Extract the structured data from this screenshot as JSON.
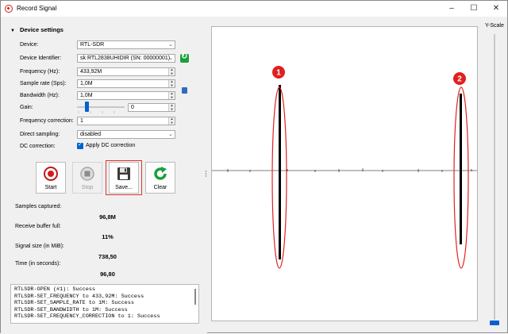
{
  "window": {
    "title": "Record Signal",
    "minimize": "–",
    "maximize": "☐",
    "close": "✕"
  },
  "device_settings": {
    "header": "Device settings",
    "device": {
      "label": "Device:",
      "value": "RTL-SDR"
    },
    "identifier": {
      "label": "Device Identifier:",
      "value": "sk RTL2838UHIDIR (SN: 00000001)"
    },
    "frequency": {
      "label": "Frequency (Hz):",
      "value": "433,92M"
    },
    "sample_rate": {
      "label": "Sample rate (Sps):",
      "value": "1,0M"
    },
    "bandwidth": {
      "label": "Bandwidth (Hz):",
      "value": "1,0M"
    },
    "gain": {
      "label": "Gain:",
      "value": "0"
    },
    "freq_correction": {
      "label": "Frequency correction:",
      "value": "1"
    },
    "direct_sampling": {
      "label": "Direct sampling:",
      "value": "disabled"
    },
    "dc_correction": {
      "label": "DC correction:",
      "checkbox_label": "Apply DC correction",
      "checked": true
    }
  },
  "buttons": {
    "start": "Start",
    "stop": "Stop",
    "save": "Save...",
    "clear": "Clear"
  },
  "stats": {
    "samples_label": "Samples captured:",
    "samples_value": "96,8M",
    "buffer_label": "Receive buffer full:",
    "buffer_value": "11%",
    "size_label": "Signal size (in MiB):",
    "size_value": "738,50",
    "time_label": "Time (in seconds):",
    "time_value": "96,80"
  },
  "log": {
    "text": "RTLSDR-OPEN (#1): Success\nRTLSDR-SET_FREQUENCY to 433,92M: Success\nRTLSDR-SET_SAMPLE_RATE to 1M: Success\nRTLSDR-SET_BANDWIDTH to 1M: Success\nRTLSDR-SET_FREQUENCY_CORRECTION to 1: Success"
  },
  "plot": {
    "marker_1": "1",
    "marker_2": "2",
    "annotation_color": "#e02020",
    "signal_color": "#000000"
  },
  "yscale": {
    "label": "Y-Scale",
    "level": 0.0
  },
  "colors": {
    "accent": "#0063d1",
    "highlight": "#e23030",
    "start_red": "#d01b1b",
    "clear_green": "#1a9f3a"
  }
}
